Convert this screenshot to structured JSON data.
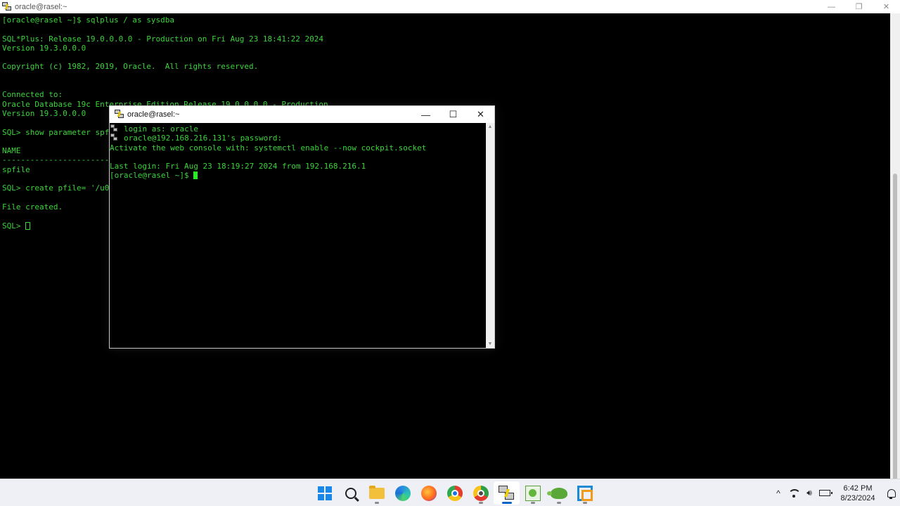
{
  "main_window": {
    "title": "oracle@rasel:~",
    "controls": {
      "minimize": "—",
      "restore": "❐",
      "close": "✕"
    },
    "lines": [
      "[oracle@rasel ~]$ sqlplus / as sysdba",
      "",
      "SQL*Plus: Release 19.0.0.0.0 - Production on Fri Aug 23 18:41:22 2024",
      "Version 19.3.0.0.0",
      "",
      "Copyright (c) 1982, 2019, Oracle.  All rights reserved.",
      "",
      "",
      "Connected to:",
      "Oracle Database 19c Enterprise Edition Release 19.0.0.0.0 - Production",
      "Version 19.3.0.0.0",
      "",
      "SQL> show parameter spf",
      "",
      "NAME",
      "------------------------",
      "spfile",
      "",
      "SQL> create pfile= '/u0",
      "",
      "File created.",
      ""
    ],
    "prompt": "SQL> "
  },
  "dialog_window": {
    "title": "oracle@rasel:~",
    "controls": {
      "minimize": "—",
      "maximize": "☐",
      "close": "✕"
    },
    "line1": "login as: oracle",
    "line2": "oracle@192.168.216.131's password:",
    "line3": "Activate the web console with: systemctl enable --now cockpit.socket",
    "line4": "",
    "line5": "Last login: Fri Aug 23 18:19:27 2024 from 192.168.216.1",
    "prompt": "[oracle@rasel ~]$ "
  },
  "taskbar": {
    "icons": [
      "start-icon",
      "search-icon",
      "file-explorer-icon",
      "edge-icon",
      "firefox-icon",
      "chrome-icon",
      "chrome-profile-icon",
      "putty-icon",
      "winscp-icon",
      "turtle-app-icon",
      "vmware-icon"
    ],
    "tray": {
      "chevron": "^",
      "time": "6:42 PM",
      "date": "8/23/2024"
    }
  }
}
